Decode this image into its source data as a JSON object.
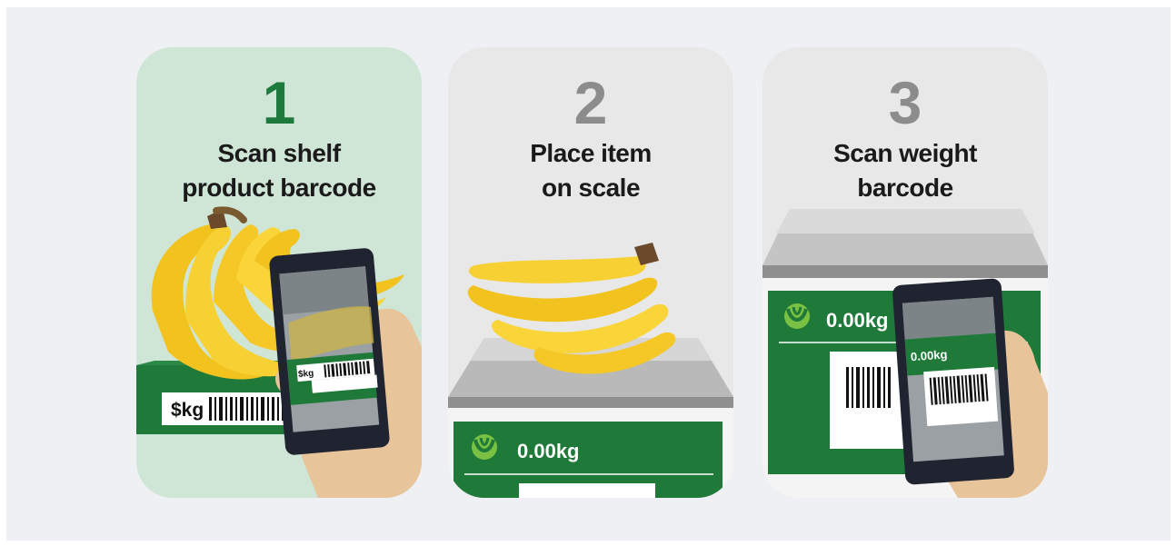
{
  "steps": [
    {
      "number": "1",
      "title": "Scan shelf\nproduct barcode"
    },
    {
      "number": "2",
      "title": "Place item\non scale"
    },
    {
      "number": "3",
      "title": "Scan weight\nbarcode"
    }
  ],
  "shelf_label": {
    "price_unit": "$kg",
    "phone_price_unit": "$kg"
  },
  "scale": {
    "weight_display": "0.00kg"
  },
  "weight_label": {
    "weight": "0.00kg",
    "phone_weight": "0.00kg"
  },
  "icons": [
    "banana-bunch-icon",
    "smartphone-icon",
    "hand-icon",
    "barcode-icon",
    "woolworths-logo-icon",
    "scale-icon"
  ],
  "colors": {
    "brand_green": "#1e7a3c",
    "label_green": "#1f7a3a",
    "banana_yellow": "#f7c92b",
    "card_green_bg": "#cfe6d6",
    "card_grey_bg": "#e8e8e8",
    "step_grey": "#8c8c8c"
  }
}
